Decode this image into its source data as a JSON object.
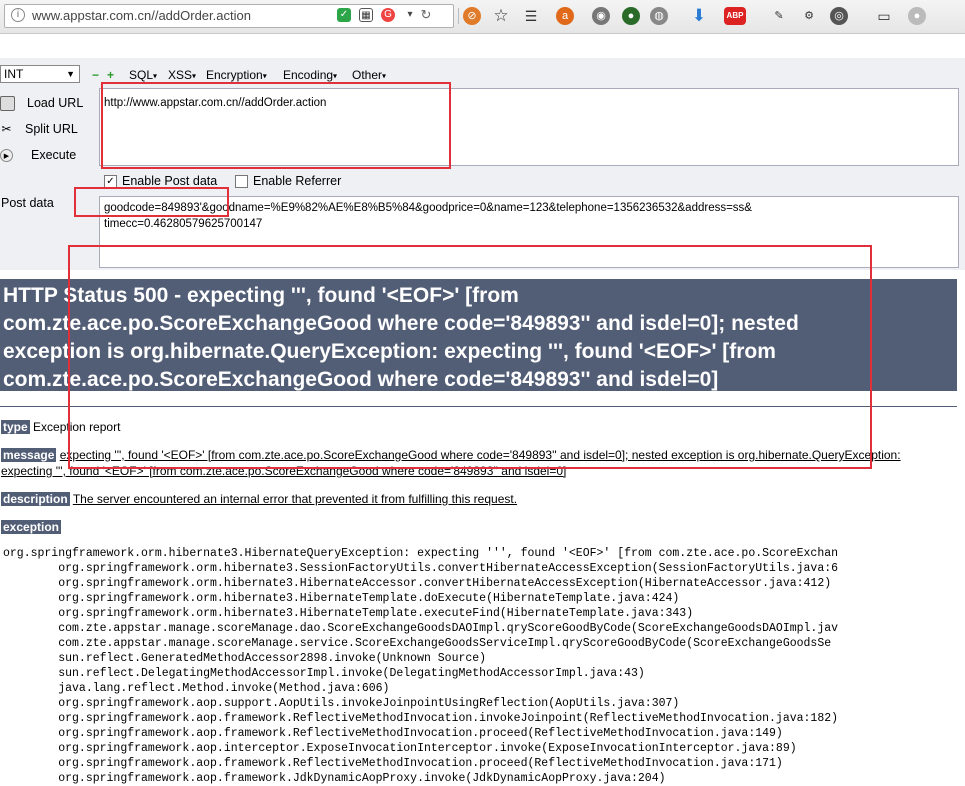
{
  "browser": {
    "url": "www.appstar.com.cn//addOrder.action",
    "icons": [
      "page-info-icon",
      "shield-icon",
      "qr-icon",
      "rss-icon",
      "dropdown-icon",
      "reload-icon",
      "no-image-icon",
      "bookmark-star-icon",
      "reading-list-icon",
      "avast-icon",
      "palette-icon",
      "extension-green-icon",
      "globe-icon",
      "download-icon",
      "abp-icon",
      "paint-icon",
      "eye-icon",
      "window-icon",
      "profile-icon"
    ],
    "abp_label": "ABP"
  },
  "hackbar": {
    "select_value": "INT",
    "menus": [
      "SQL",
      "XSS",
      "Encryption",
      "Encoding",
      "Other"
    ],
    "actions": {
      "load": "Load URL",
      "split": "Split URL",
      "execute": "Execute"
    },
    "url_value": "http://www.appstar.com.cn//addOrder.action",
    "enable_post": "Enable Post data",
    "enable_post_checked": true,
    "enable_referrer": "Enable Referrer",
    "enable_referrer_checked": false,
    "post_label": "Post data",
    "post_line1": "goodcode=849893'&goodname=%E9%82%AE%E8%B5%84&goodprice=0&name=123&telephone=1356236532&address=ss&",
    "post_line2": "timecc=0.46280579625700147"
  },
  "page": {
    "title_lines": [
      "HTTP Status 500 - expecting ''', found '<EOF>' [from",
      "com.zte.ace.po.ScoreExchangeGood where code='849893'' and isdel=0]; nested",
      "exception is org.hibernate.QueryException: expecting ''', found '<EOF>' [from",
      "com.zte.ace.po.ScoreExchangeGood where code='849893'' and isdel=0]"
    ],
    "type_label": "type",
    "type_value": "Exception report",
    "message_label": "message",
    "message_line1": "expecting ''', found '<EOF>' [from com.zte.ace.po.ScoreExchangeGood where code='849893'' and isdel=0]; nested exception is org.hibernate.QueryException:",
    "message_line2": "expecting ''', found '<EOF>' [from com.zte.ace.po.ScoreExchangeGood where code='849893'' and isdel=0]",
    "description_label": "description",
    "description_value": "The server encountered an internal error that prevented it from fulfilling this request.",
    "exception_label": "exception",
    "stack": [
      "org.springframework.orm.hibernate3.HibernateQueryException: expecting ''', found '<EOF>' [from com.zte.ace.po.ScoreExchan",
      "\torg.springframework.orm.hibernate3.SessionFactoryUtils.convertHibernateAccessException(SessionFactoryUtils.java:6",
      "\torg.springframework.orm.hibernate3.HibernateAccessor.convertHibernateAccessException(HibernateAccessor.java:412)",
      "\torg.springframework.orm.hibernate3.HibernateTemplate.doExecute(HibernateTemplate.java:424)",
      "\torg.springframework.orm.hibernate3.HibernateTemplate.executeFind(HibernateTemplate.java:343)",
      "\tcom.zte.appstar.manage.scoreManage.dao.ScoreExchangeGoodsDAOImpl.qryScoreGoodByCode(ScoreExchangeGoodsDAOImpl.jav",
      "\tcom.zte.appstar.manage.scoreManage.service.ScoreExchangeGoodsServiceImpl.qryScoreGoodByCode(ScoreExchangeGoodsSe",
      "\tsun.reflect.GeneratedMethodAccessor2898.invoke(Unknown Source)",
      "\tsun.reflect.DelegatingMethodAccessorImpl.invoke(DelegatingMethodAccessorImpl.java:43)",
      "\tjava.lang.reflect.Method.invoke(Method.java:606)",
      "\torg.springframework.aop.support.AopUtils.invokeJoinpointUsingReflection(AopUtils.java:307)",
      "\torg.springframework.aop.framework.ReflectiveMethodInvocation.invokeJoinpoint(ReflectiveMethodInvocation.java:182)",
      "\torg.springframework.aop.framework.ReflectiveMethodInvocation.proceed(ReflectiveMethodInvocation.java:149)",
      "\torg.springframework.aop.interceptor.ExposeInvocationInterceptor.invoke(ExposeInvocationInterceptor.java:89)",
      "\torg.springframework.aop.framework.ReflectiveMethodInvocation.proceed(ReflectiveMethodInvocation.java:171)",
      "\torg.springframework.aop.framework.JdkDynamicAopProxy.invoke(JdkDynamicAopProxy.java:204)"
    ]
  },
  "colors": {
    "header_bg": "#525d76",
    "annotation_red": "#e2303a",
    "hackbar_bg": "#eef0f3"
  }
}
